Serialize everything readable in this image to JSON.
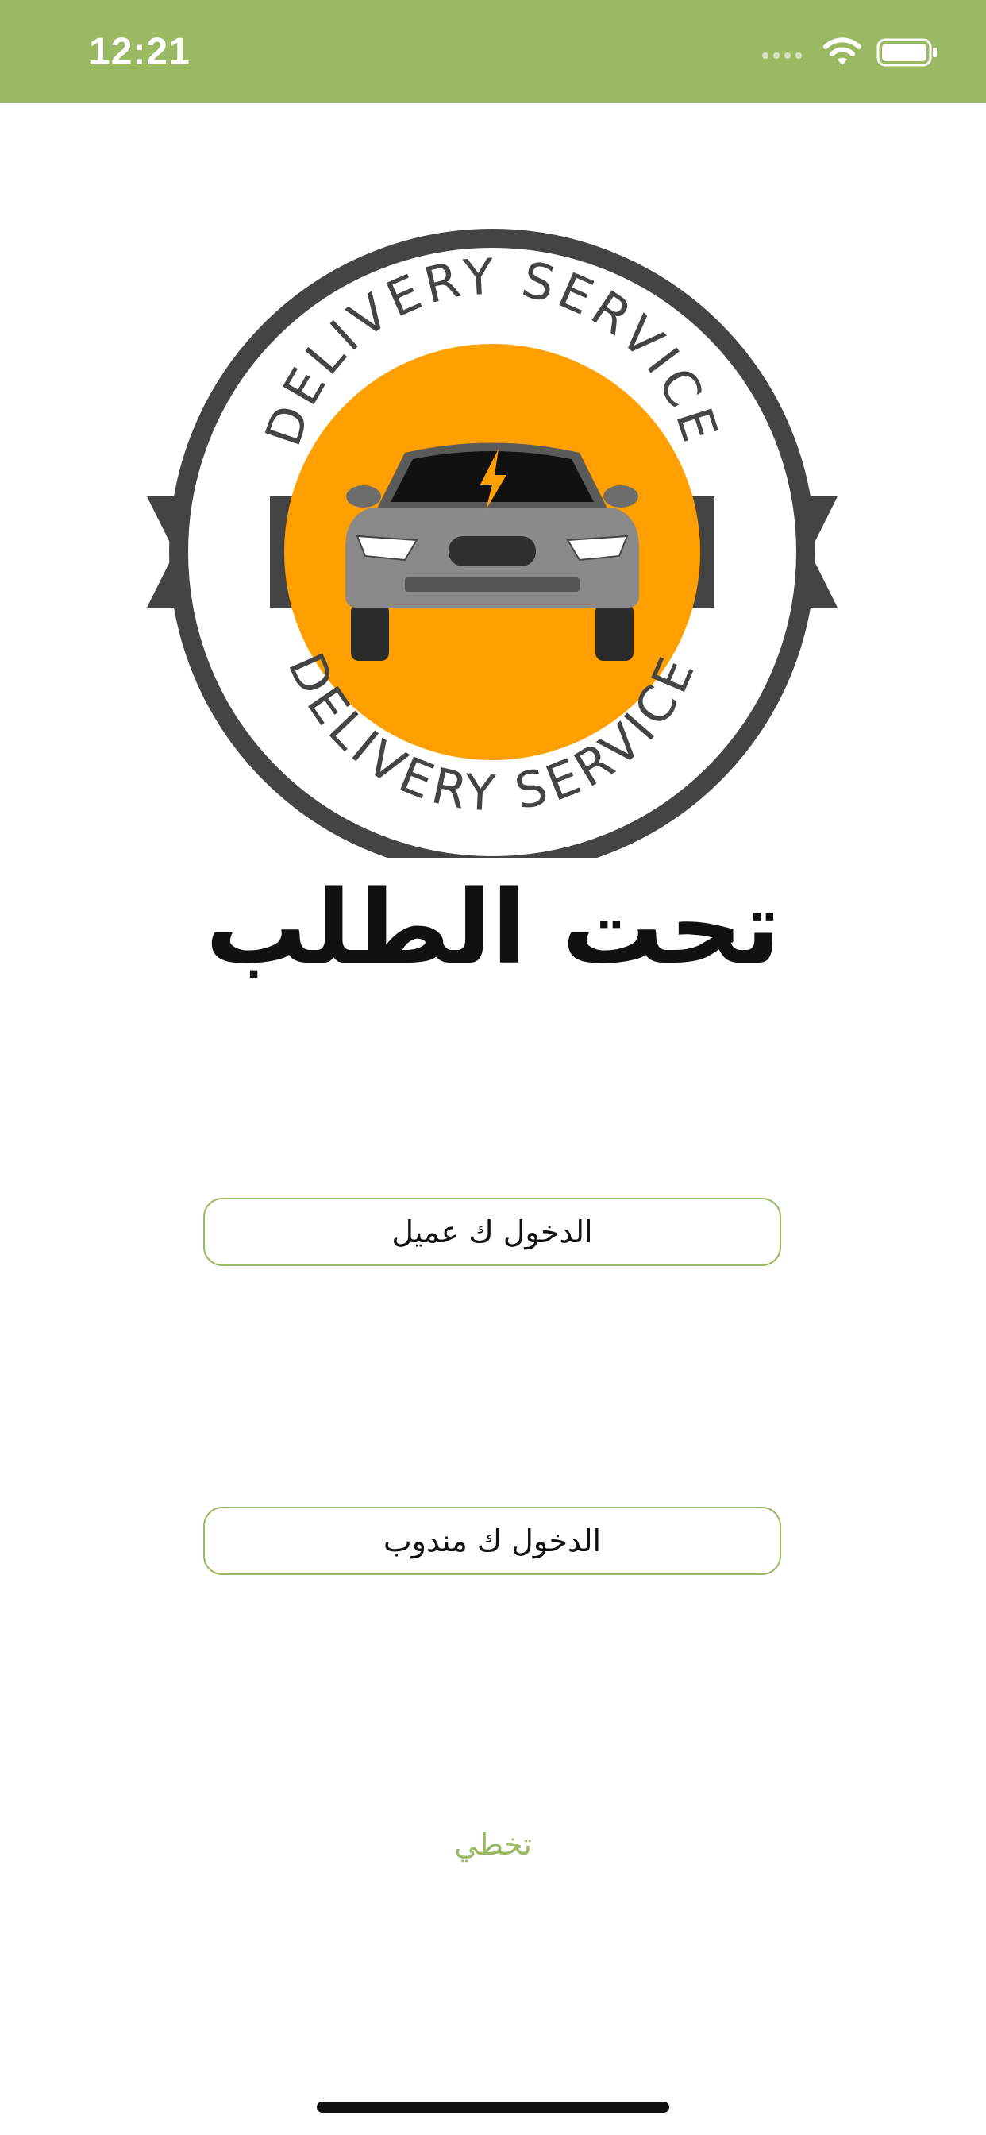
{
  "status_bar": {
    "time": "12:21",
    "background": "#9bb962",
    "icons": [
      "signal-icon",
      "wifi-icon",
      "battery-icon"
    ]
  },
  "logo": {
    "ring_text_top": "DELIVERY SERVICE",
    "ring_text_bottom": "DELIVERY SERVICE",
    "brand_name": "تحت الطلب",
    "colors": {
      "ring": "#444444",
      "circle": "#ff9f00",
      "car": "#808080",
      "bolt": "#ff9f00"
    }
  },
  "buttons": {
    "customer_login": "الدخول ك عميل",
    "agent_login": "الدخول ك مندوب",
    "border_color": "#9bb962"
  },
  "skip": {
    "label": "تخطي",
    "color": "#9bb962"
  }
}
